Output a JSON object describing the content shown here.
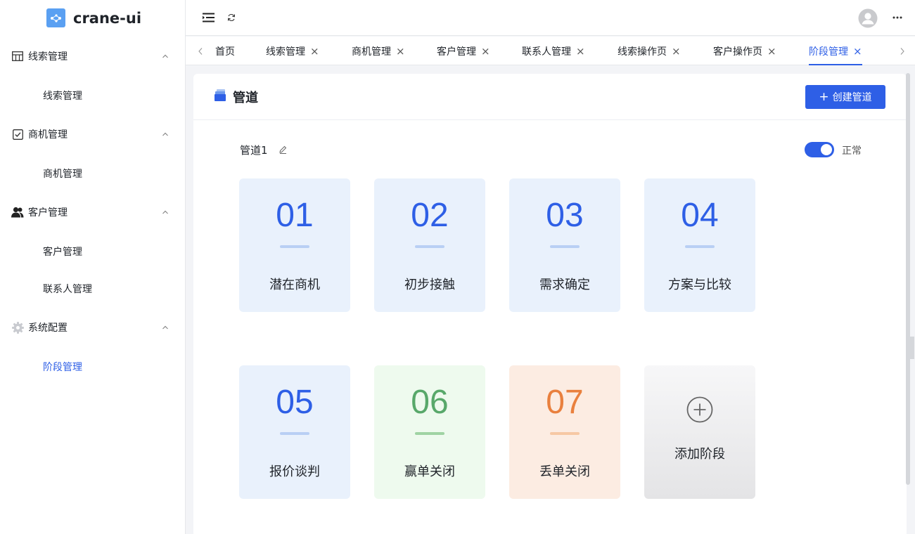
{
  "app": {
    "name": "crane-ui"
  },
  "sidebar": {
    "groups": [
      {
        "label": "线索管理",
        "icon": "table-icon",
        "items": [
          {
            "label": "线索管理",
            "active": false
          }
        ]
      },
      {
        "label": "商机管理",
        "icon": "checkbox-icon",
        "items": [
          {
            "label": "商机管理",
            "active": false
          }
        ]
      },
      {
        "label": "客户管理",
        "icon": "users-icon",
        "items": [
          {
            "label": "客户管理",
            "active": false
          },
          {
            "label": "联系人管理",
            "active": false
          }
        ]
      },
      {
        "label": "系统配置",
        "icon": "gear-icon",
        "items": [
          {
            "label": "阶段管理",
            "active": true
          }
        ]
      }
    ]
  },
  "tabs": [
    {
      "label": "首页",
      "closable": false
    },
    {
      "label": "线索管理",
      "closable": true
    },
    {
      "label": "商机管理",
      "closable": true
    },
    {
      "label": "客户管理",
      "closable": true
    },
    {
      "label": "联系人管理",
      "closable": true
    },
    {
      "label": "线索操作页",
      "closable": true
    },
    {
      "label": "客户操作页",
      "closable": true
    },
    {
      "label": "阶段管理",
      "closable": true,
      "active": true
    }
  ],
  "tab_close_glyph": "×",
  "page": {
    "title": "管道",
    "create_button": "创建管道",
    "create_icon": "+",
    "pipeline": {
      "name": "管道1",
      "status_label": "正常",
      "enabled": true,
      "stages": [
        {
          "num": "01",
          "name": "潜在商机",
          "color": "#2e5fe6"
        },
        {
          "num": "02",
          "name": "初步接触",
          "color": "#2e5fe6"
        },
        {
          "num": "03",
          "name": "需求确定",
          "color": "#2e5fe6"
        },
        {
          "num": "04",
          "name": "方案与比较",
          "color": "#2e5fe6"
        },
        {
          "num": "05",
          "name": "报价谈判",
          "color": "#2e5fe6"
        },
        {
          "num": "06",
          "name": "赢单关闭",
          "color": "#58a86a"
        },
        {
          "num": "07",
          "name": "丢单关闭",
          "color": "#e9803e"
        }
      ],
      "add_stage_label": "添加阶段"
    }
  },
  "colors": {
    "primary": "#2e5fe6",
    "win": "#58a86a",
    "lose": "#e9803e"
  }
}
